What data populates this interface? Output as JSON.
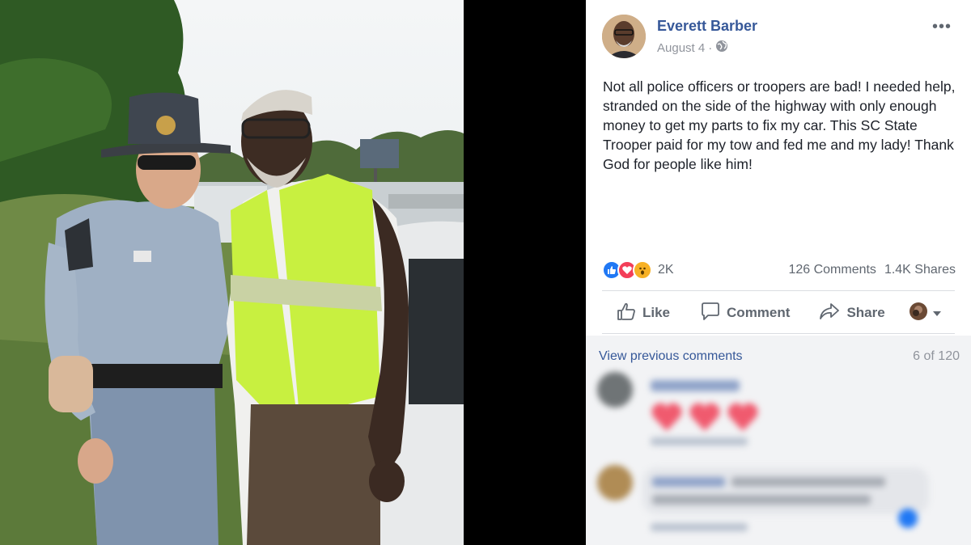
{
  "post": {
    "author": "Everett Barber",
    "date": "August 4",
    "separator": "·",
    "text": "Not all police officers or troopers are bad! I needed help, stranded on the side of the highway with only enough money to get my parts to fix my car. This SC State Trooper paid for my tow and fed me and my lady! Thank God for people like him!",
    "more_label": "•••"
  },
  "reactions": {
    "icons": [
      "like-reaction-icon",
      "love-reaction-icon",
      "wow-reaction-icon"
    ],
    "count": "2K",
    "comments": "126 Comments",
    "shares": "1.4K Shares"
  },
  "actions": {
    "like": "Like",
    "comment": "Comment",
    "share": "Share"
  },
  "comments": {
    "view_previous": "View previous comments",
    "position": "6 of 120"
  },
  "colors": {
    "link": "#365899",
    "muted": "#90949c",
    "action": "#606770",
    "like": "#2078f4",
    "love": "#f33e58",
    "wow": "#f7b125",
    "vest": "#c8f040"
  }
}
